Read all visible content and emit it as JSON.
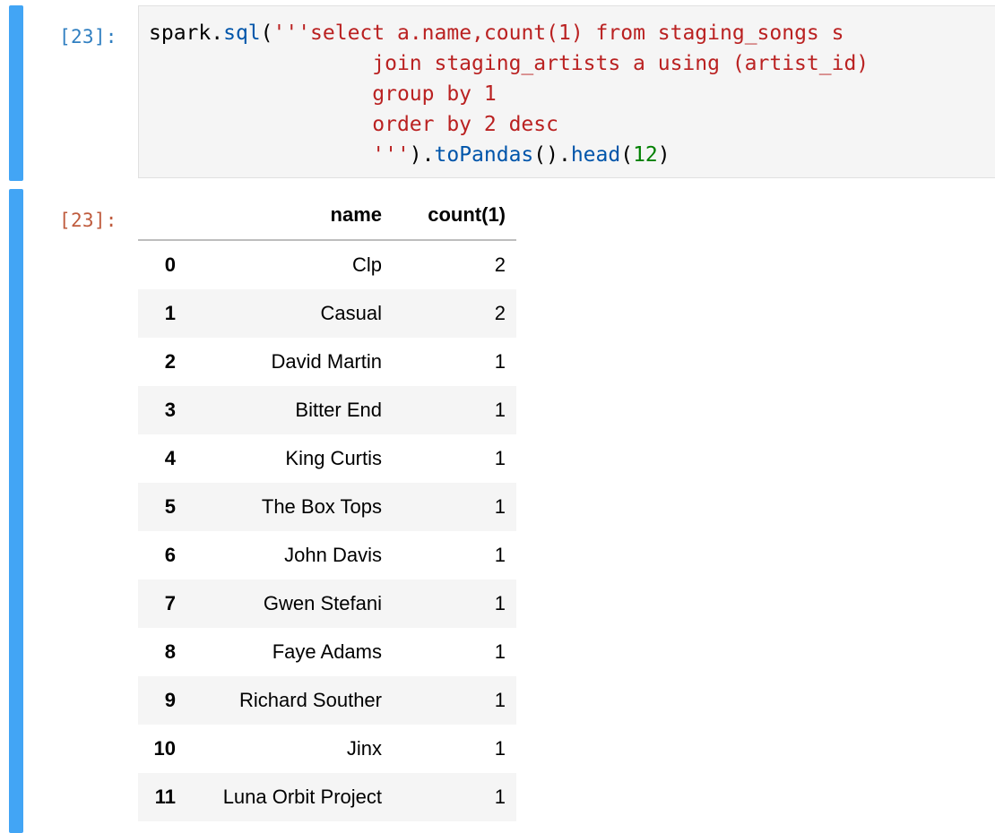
{
  "input_cell": {
    "prompt": "[23]:",
    "code_tokens": [
      [
        {
          "t": "plain",
          "s": "spark."
        },
        {
          "t": "fn",
          "s": "sql"
        },
        {
          "t": "plain",
          "s": "("
        },
        {
          "t": "str",
          "s": "'''select a.name,count(1) from staging_songs s"
        }
      ],
      [
        {
          "t": "str",
          "s": "                  join staging_artists a using (artist_id)"
        }
      ],
      [
        {
          "t": "str",
          "s": "                  group by 1"
        }
      ],
      [
        {
          "t": "str",
          "s": "                  order by 2 desc"
        }
      ],
      [
        {
          "t": "str",
          "s": "                  '''"
        },
        {
          "t": "plain",
          "s": ")."
        },
        {
          "t": "fn",
          "s": "toPandas"
        },
        {
          "t": "plain",
          "s": "()."
        },
        {
          "t": "fn",
          "s": "head"
        },
        {
          "t": "plain",
          "s": "("
        },
        {
          "t": "num",
          "s": "12"
        },
        {
          "t": "plain",
          "s": ")"
        }
      ]
    ]
  },
  "output_cell": {
    "prompt": "[23]:",
    "table": {
      "columns": [
        "",
        "name",
        "count(1)"
      ],
      "rows": [
        {
          "index": "0",
          "name": "Clp",
          "count": "2"
        },
        {
          "index": "1",
          "name": "Casual",
          "count": "2"
        },
        {
          "index": "2",
          "name": "David Martin",
          "count": "1"
        },
        {
          "index": "3",
          "name": "Bitter End",
          "count": "1"
        },
        {
          "index": "4",
          "name": "King Curtis",
          "count": "1"
        },
        {
          "index": "5",
          "name": "The Box Tops",
          "count": "1"
        },
        {
          "index": "6",
          "name": "John Davis",
          "count": "1"
        },
        {
          "index": "7",
          "name": "Gwen Stefani",
          "count": "1"
        },
        {
          "index": "8",
          "name": "Faye Adams",
          "count": "1"
        },
        {
          "index": "9",
          "name": "Richard Souther",
          "count": "1"
        },
        {
          "index": "10",
          "name": "Jinx",
          "count": "1"
        },
        {
          "index": "11",
          "name": "Luna Orbit Project",
          "count": "1"
        }
      ]
    }
  },
  "colors": {
    "cell_bar": "#42a5f5",
    "in_prompt": "#307fc1",
    "out_prompt": "#bf5b3d",
    "string": "#ba2121",
    "function": "#0055aa",
    "number": "#008000"
  }
}
